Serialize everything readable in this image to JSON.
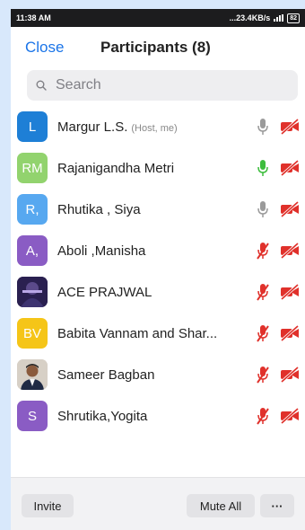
{
  "status_bar": {
    "time": "11:38 AM",
    "speed": "...23.4KB/s",
    "battery": "82"
  },
  "header": {
    "close_label": "Close",
    "title": "Participants (8)"
  },
  "search": {
    "placeholder": "Search"
  },
  "participants": [
    {
      "avatar_text": "L",
      "avatar_color": "#1e7fd6",
      "avatar_kind": "letter",
      "name": "Margur L.S.",
      "role": "(Host, me)",
      "mic_state": "on-idle",
      "video_state": "off"
    },
    {
      "avatar_text": "RM",
      "avatar_color": "#92d36e",
      "avatar_kind": "letter",
      "name": "Rajanigandha Metri",
      "role": "",
      "mic_state": "speaking",
      "video_state": "off"
    },
    {
      "avatar_text": "R,",
      "avatar_color": "#57a8f0",
      "avatar_kind": "letter",
      "name": "Rhutika , Siya",
      "role": "",
      "mic_state": "on-idle",
      "video_state": "off"
    },
    {
      "avatar_text": "A,",
      "avatar_color": "#8a5cc4",
      "avatar_kind": "letter",
      "name": "Aboli ,Manisha",
      "role": "",
      "mic_state": "muted",
      "video_state": "off"
    },
    {
      "avatar_text": "",
      "avatar_color": "#2a2050",
      "avatar_kind": "photo",
      "name": "ACE PRAJWAL",
      "role": "",
      "mic_state": "muted",
      "video_state": "off"
    },
    {
      "avatar_text": "BV",
      "avatar_color": "#f5c518",
      "avatar_kind": "letter",
      "name": "Babita Vannam and Shar...",
      "role": "",
      "mic_state": "muted",
      "video_state": "off"
    },
    {
      "avatar_text": "",
      "avatar_color": "#d7d0c6",
      "avatar_kind": "person-photo",
      "name": "Sameer Bagban",
      "role": "",
      "mic_state": "muted",
      "video_state": "off"
    },
    {
      "avatar_text": "S",
      "avatar_color": "#8a5cc4",
      "avatar_kind": "letter",
      "name": "Shrutika,Yogita",
      "role": "",
      "mic_state": "muted",
      "video_state": "off"
    }
  ],
  "footer": {
    "invite_label": "Invite",
    "mute_all_label": "Mute All",
    "more_label": "···"
  },
  "colors": {
    "accent": "#1a74e8",
    "muted_red": "#e0312b",
    "speaking_green": "#3dbd3d",
    "idle_grey": "#9a9a9a"
  },
  "icons": {
    "search": "search-icon",
    "mic": "microphone-icon",
    "mic_muted": "microphone-muted-icon",
    "video_off": "video-off-icon"
  }
}
